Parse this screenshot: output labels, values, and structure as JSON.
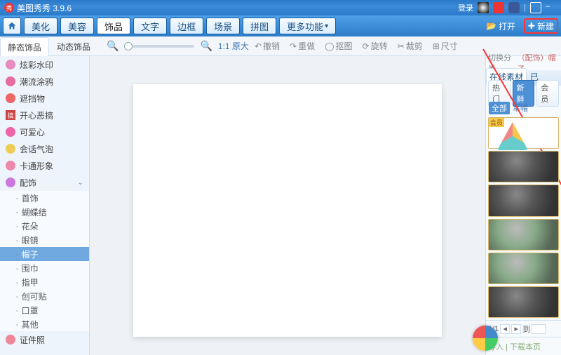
{
  "titlebar": {
    "title": "美图秀秀 3.9.6",
    "login": "登录"
  },
  "nav": {
    "tabs": [
      "美化",
      "美容",
      "饰品",
      "文字",
      "边框",
      "场景",
      "拼图",
      "更多功能"
    ],
    "active_index": 2,
    "open": "打开",
    "new": "新建"
  },
  "subbar": {
    "tabs": [
      "静态饰品",
      "动态饰品"
    ],
    "active_index": 0,
    "zoom_label": "1:1 原大",
    "toolbar": {
      "undo": "撤销",
      "redo": "重做",
      "crop": "抠图",
      "rotate": "旋转",
      "cut": "裁剪",
      "size": "尺寸"
    }
  },
  "left": {
    "cats": [
      {
        "label": "炫彩水印",
        "color": "#e88bc0"
      },
      {
        "label": "潮流涂鸦",
        "color": "#e76aa0"
      },
      {
        "label": "遮挡物",
        "color": "#e66"
      },
      {
        "label": "开心恶搞",
        "color": "#c44"
      },
      {
        "label": "可爱心",
        "color": "#e6a"
      },
      {
        "label": "会话气泡",
        "color": "#ec5"
      },
      {
        "label": "卡通形象",
        "color": "#e8a"
      }
    ],
    "expand_label": "配饰",
    "subs": [
      "首饰",
      "蝴蝶结",
      "花朵",
      "眼镜",
      "帽子",
      "围巾",
      "指甲",
      "创可贴",
      "口罩",
      "其他"
    ],
    "sub_selected": 4,
    "bottom": "证件照"
  },
  "right": {
    "switch_label": "切换分类",
    "switch_value": "（配饰）帽子",
    "tabs": [
      "在线素材",
      "已"
    ],
    "active_tab": 0,
    "filters": [
      "热门",
      "新鲜",
      "会员"
    ],
    "active_filter": 1,
    "catrow": {
      "all": "全部",
      "c2": "军帽"
    },
    "pager": {
      "cur": "1/1",
      "to": "到"
    },
    "foot": "导入 | 下载本页"
  }
}
